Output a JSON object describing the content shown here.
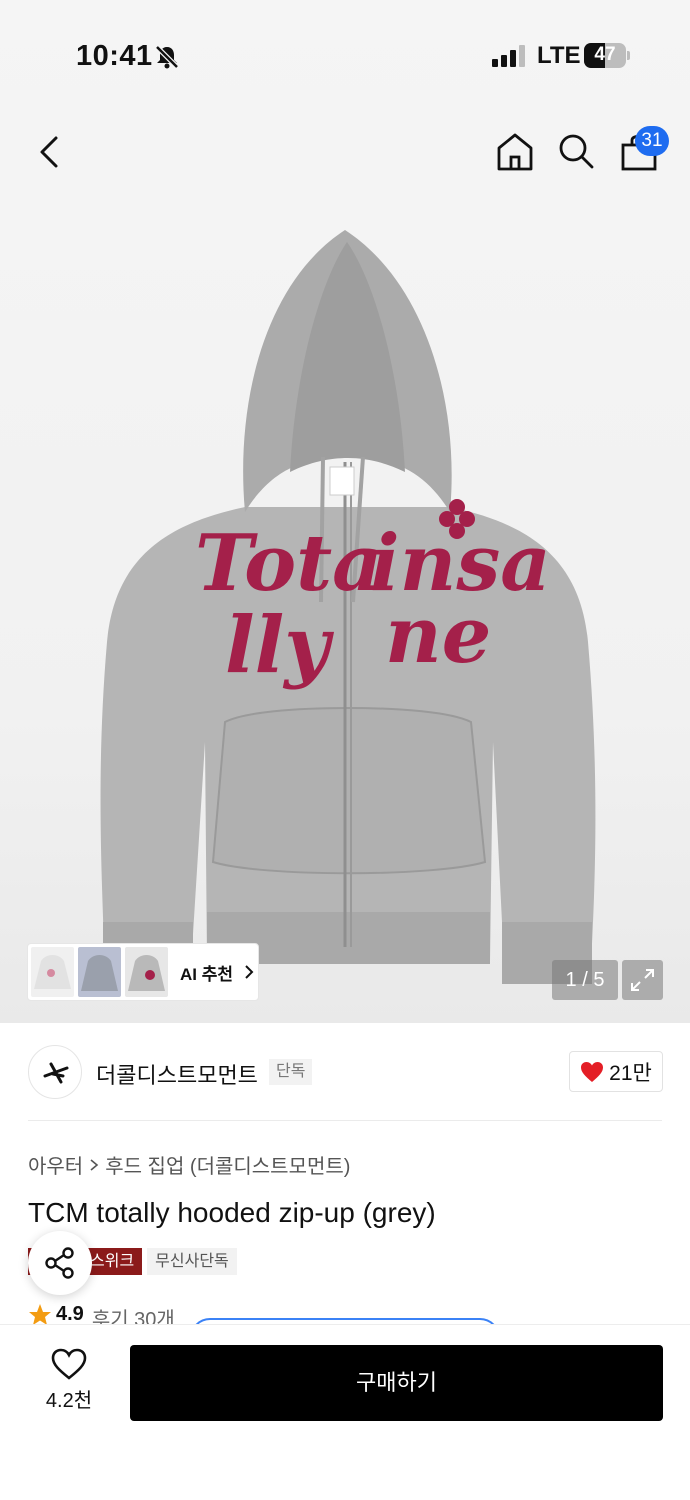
{
  "status_bar": {
    "time": "10:41",
    "network": "LTE",
    "battery": "47"
  },
  "nav": {
    "cart_count": "31"
  },
  "gallery": {
    "ai_recommend_label": "AI 추천",
    "page_indicator": "1 / 5",
    "print_text_line1": "Tota",
    "print_text_line2": "lly",
    "print_text_line3": "insa",
    "print_text_line4": "ne",
    "colors": {
      "hoodie": "#b3b3b3",
      "print": "#a4204a"
    }
  },
  "brand": {
    "name": "더콜디스트모먼트",
    "tag": "단독",
    "likes": "21만"
  },
  "product": {
    "breadcrumb": [
      "아우터",
      "후드 집업 (더콜디스트모먼트)"
    ],
    "title": "TCM totally hooded zip-up (grey)",
    "tag_red": "스위크",
    "tag_grey": "무신사단독",
    "rating": "4.9",
    "reviews": "후기 30개"
  },
  "bottom_bar": {
    "wish_count": "4.2천",
    "buy_label": "구매하기"
  },
  "icons": [
    "bell-slash-icon",
    "back-icon",
    "home-icon",
    "search-icon",
    "cart-icon",
    "chevron-right-icon",
    "expand-icon",
    "heart-icon",
    "share-icon",
    "star-icon"
  ]
}
